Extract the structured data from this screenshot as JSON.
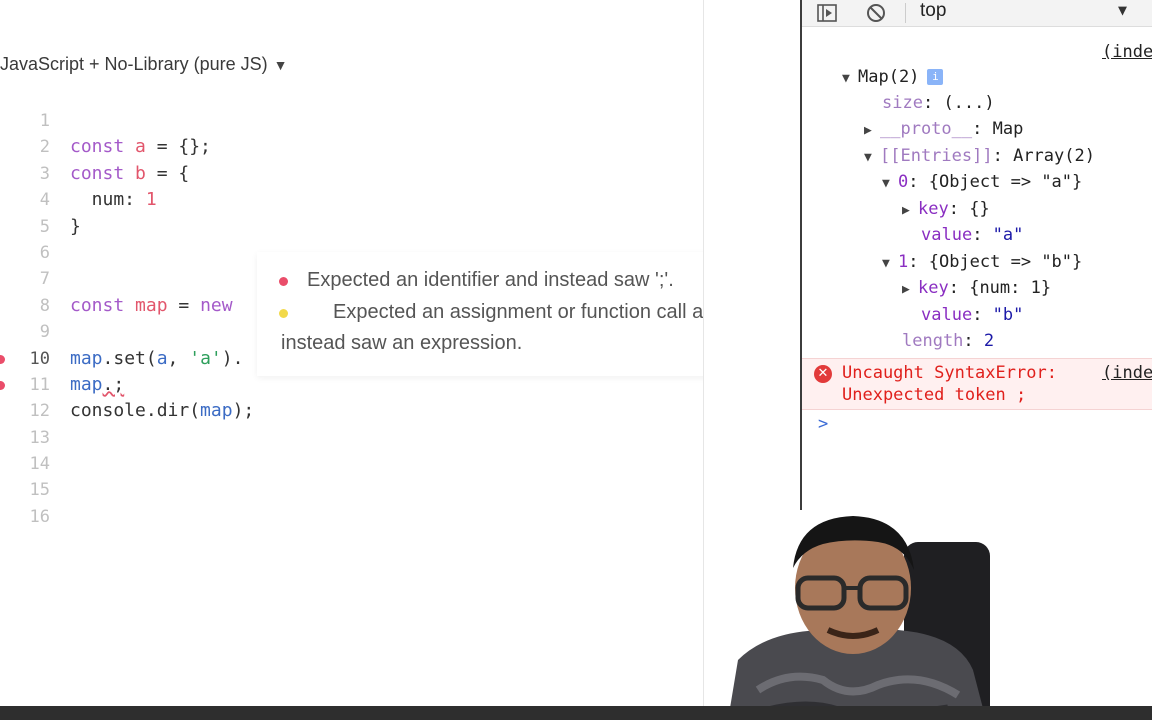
{
  "editor": {
    "language_label": "JavaScript + No-Library (pure JS)",
    "line_numbers": [
      "1",
      "2",
      "3",
      "4",
      "5",
      "6",
      "7",
      "8",
      "9",
      "10",
      "11",
      "12",
      "13",
      "14",
      "15",
      "16"
    ],
    "lines": {
      "l2": {
        "kw": "const",
        "var": "a",
        "rest": " = {};"
      },
      "l3": {
        "kw": "const",
        "var": "b",
        "rest": " = {"
      },
      "l4": {
        "key": "  num: ",
        "num": "1"
      },
      "l5": {
        "text": "}"
      },
      "l8": {
        "kw": "const",
        "var": "map",
        "rest": " = ",
        "kw2": "new"
      },
      "l10": {
        "id": "map",
        "call": ".set(",
        "id2": "a",
        "sep": ", ",
        "str": "'a'",
        "tail": ")."
      },
      "l11": {
        "id": "map",
        "tail": ".;"
      },
      "l12": {
        "obj": "console",
        "call": ".dir(",
        "id": "map",
        "tail": ");"
      }
    },
    "tooltip": {
      "error1": "Expected an identifier and instead saw ';'.",
      "error2": "Expected an assignment or function call and instead saw an expression."
    }
  },
  "devtools": {
    "context": "top",
    "source_link": "(inde",
    "tree": {
      "map_label": "Map(2)",
      "info": "i",
      "size_key": "size",
      "size_val": "(...)",
      "proto_key": "__proto__",
      "proto_val": "Map",
      "entries_key": "[[Entries]]",
      "entries_val": "Array(2)",
      "e0_key": "0",
      "e0_val": "{Object => \"a\"}",
      "e0_k_key": "key",
      "e0_k_val": "{}",
      "e0_v_key": "value",
      "e0_v_val": "\"a\"",
      "e1_key": "1",
      "e1_val": "{Object => \"b\"}",
      "e1_k_key": "key",
      "e1_k_val": "{num: 1}",
      "e1_v_key": "value",
      "e1_v_val": "\"b\"",
      "len_key": "length",
      "len_val": "2"
    },
    "error": {
      "line1": "Uncaught SyntaxError:",
      "line2": "Unexpected token ;",
      "link": "(inde"
    },
    "prompt": ">"
  },
  "colors": {
    "error_red": "#e0201c",
    "keyword_purple": "#a45ac9",
    "variable_red": "#e2566c",
    "string_green": "#2e9f5c",
    "warning_yellow": "#f2d94a"
  }
}
